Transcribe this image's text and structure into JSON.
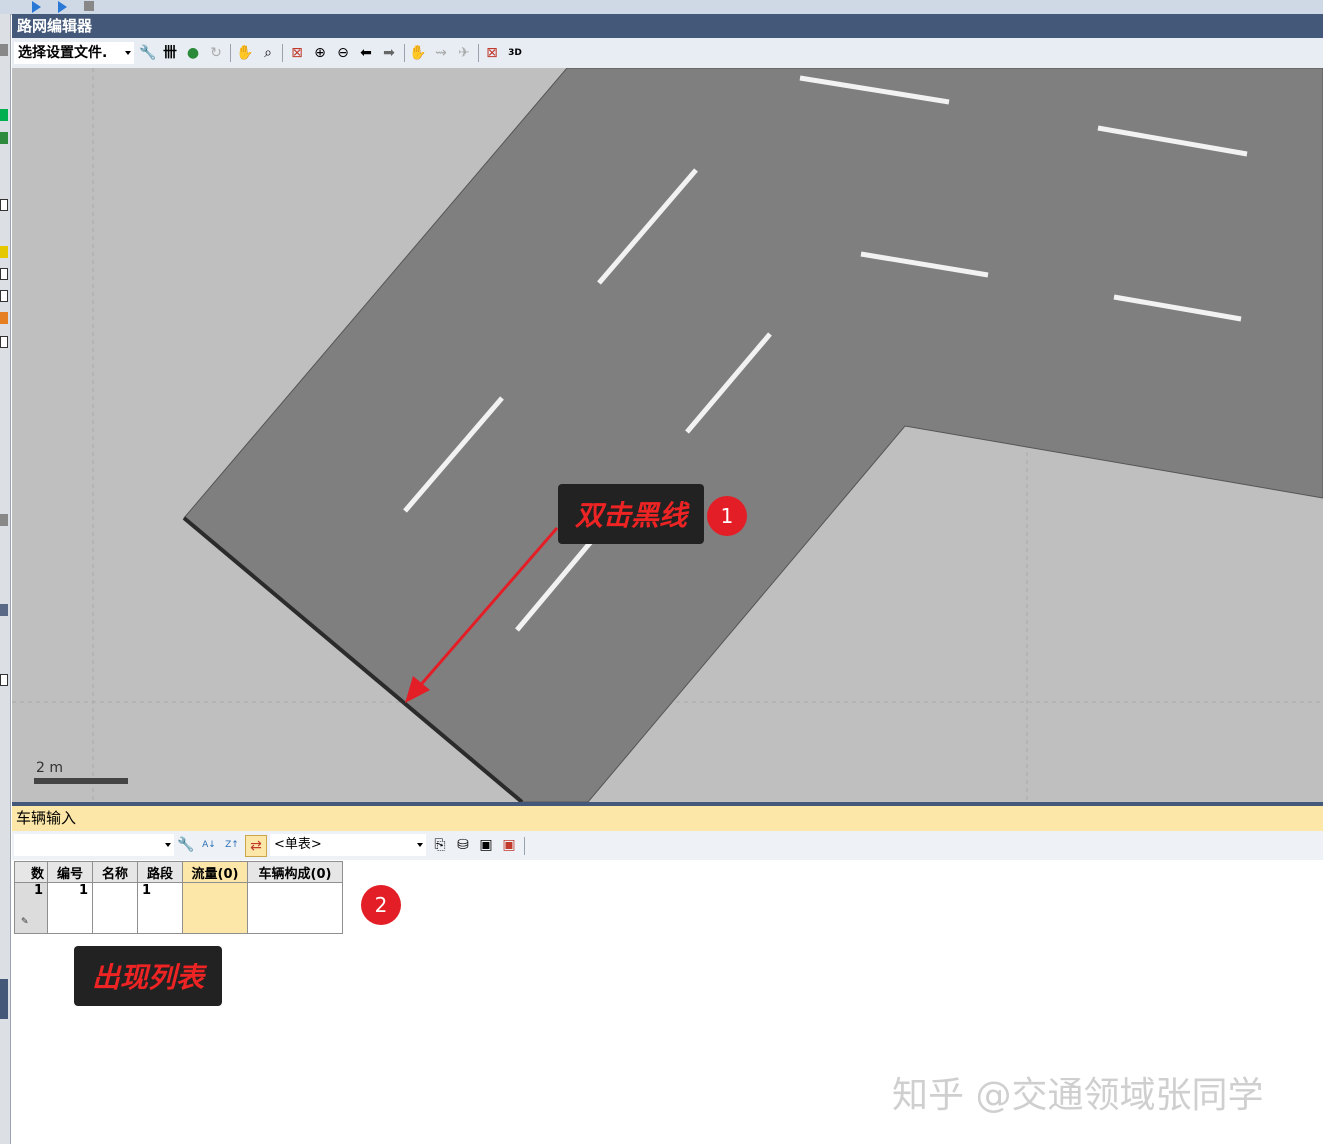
{
  "window": {
    "title": "路网编辑器"
  },
  "toolbar": {
    "config_select": "选择设置文件."
  },
  "canvas": {
    "scale_label": "2 m"
  },
  "annotations": {
    "step1_text": "双击黑线",
    "step1_badge": "1",
    "step2_text": "出现列表",
    "step2_badge": "2"
  },
  "vehicle_input": {
    "title": "车辆输入",
    "view_select": "<单表>",
    "columns": [
      "数",
      "编号",
      "名称",
      "路段",
      "流量(0)",
      "车辆构成(0)"
    ],
    "rows": [
      {
        "count": "1",
        "id": "1",
        "name": "",
        "link": "1",
        "volume": "",
        "composition": ""
      }
    ]
  },
  "watermark": "知乎 @交通领域张同学",
  "colors": {
    "title_bar": "#44597a",
    "panel_header": "#fde7a8",
    "road": "#7f7f7f",
    "background": "#bfbfbf",
    "callout_text": "#ee2323",
    "badge": "#e31e26"
  },
  "icons": [
    "play-icon",
    "step-icon",
    "stop-icon",
    "wrench-icon",
    "grid-icon",
    "globe-icon",
    "refresh-icon",
    "pan-icon",
    "zoom-search-icon",
    "zoom-extent-icon",
    "zoom-in-icon",
    "zoom-out-icon",
    "back-arrow-icon",
    "forward-arrow-icon",
    "hand-icon",
    "copy-icon",
    "database-icon",
    "save-icon",
    "save-as-icon",
    "sort-az-icon",
    "sort-za-icon",
    "sync-icon"
  ]
}
